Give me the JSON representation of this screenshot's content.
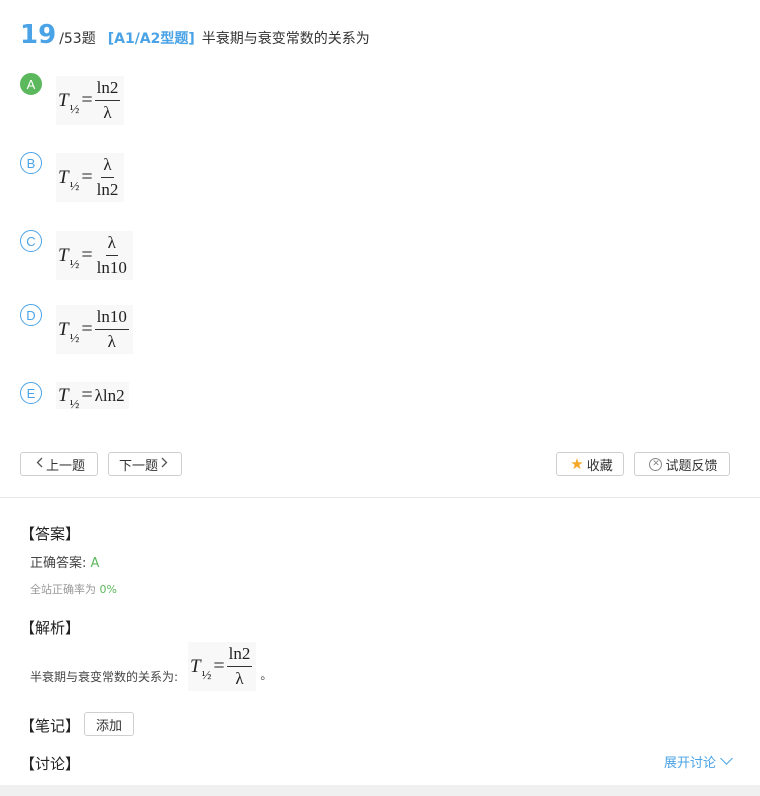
{
  "question": {
    "number": "19",
    "total": "/53题",
    "type": "[A1/A2型题]",
    "stem": "半衰期与衰变常数的关系为"
  },
  "options": [
    {
      "letter": "A",
      "T": "T",
      "sub": "½",
      "eq": "=",
      "num": "ln2",
      "den": "λ",
      "correct": true
    },
    {
      "letter": "B",
      "T": "T",
      "sub": "½",
      "eq": "=",
      "num": "λ",
      "den": "ln2"
    },
    {
      "letter": "C",
      "T": "T",
      "sub": "½",
      "eq": "=",
      "num": "λ",
      "den": "ln10"
    },
    {
      "letter": "D",
      "T": "T",
      "sub": "½",
      "eq": "=",
      "num": "ln10",
      "den": "λ"
    },
    {
      "letter": "E",
      "T": "T",
      "sub": "½",
      "eq": "=",
      "rhs": "λln2"
    }
  ],
  "nav": {
    "prev_icon": "chevron-left-icon",
    "prev": "上一题",
    "next": "下一题",
    "next_icon": "chevron-right-icon",
    "favorite_icon": "star-icon",
    "favorite": "收藏",
    "feedback_icon": "close-circle-icon",
    "feedback": "试题反馈"
  },
  "answer": {
    "title": "【答案】",
    "correct_label": "正确答案: ",
    "correct_value": "A",
    "rate_label": "全站正确率为 ",
    "rate_value": "0%"
  },
  "analysis": {
    "title": "【解析】",
    "text": "半衰期与衰变常数的关系为:",
    "T": "T",
    "sub": "½",
    "eq": "=",
    "num": "ln2",
    "den": "λ",
    "period": "。"
  },
  "notes": {
    "title": "【笔记】",
    "add": "添加"
  },
  "discussion": {
    "title": "【讨论】",
    "expand": "展开讨论",
    "expand_icon": "chevron-down-icon"
  },
  "colors": {
    "accent": "#4aa3e6",
    "correct": "#5cb85c",
    "star": "#f5a623"
  }
}
